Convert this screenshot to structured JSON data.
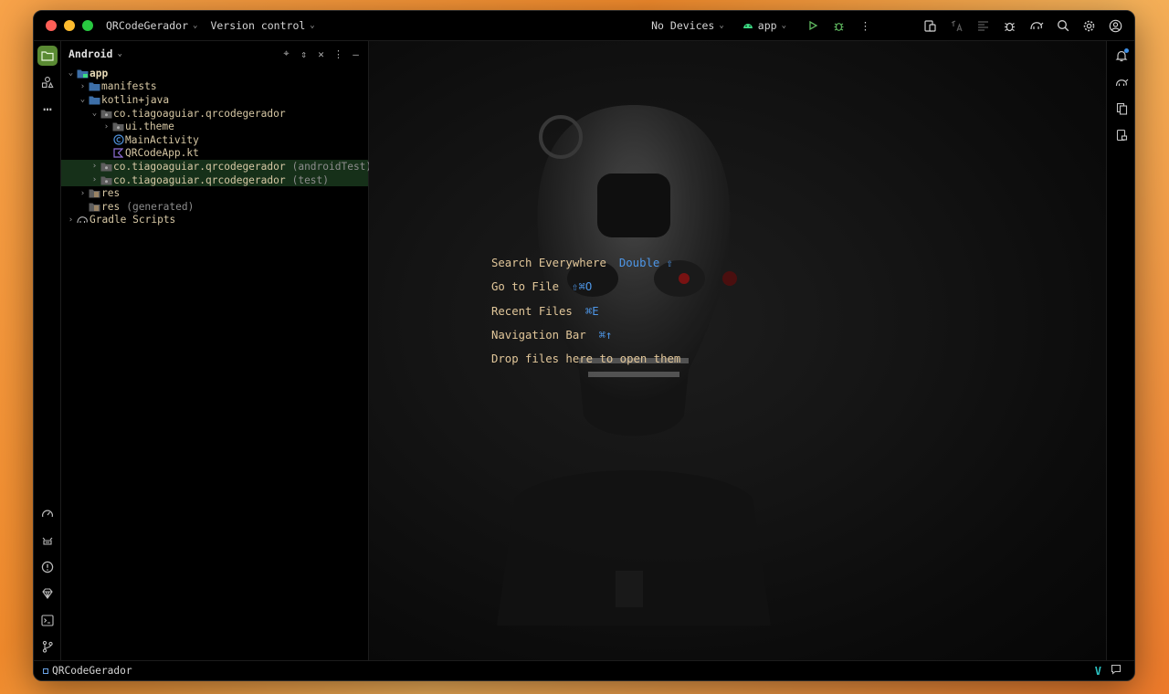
{
  "titlebar": {
    "project_name": "QRCodeGerador",
    "vcs_label": "Version control",
    "device_label": "No Devices",
    "run_config": "app"
  },
  "project_panel": {
    "view_name": "Android",
    "tree": {
      "app": "app",
      "manifests": "manifests",
      "kotlin_java": "kotlin+java",
      "pkg_main": "co.tiagoaguiar.qrcodegerador",
      "ui_theme": "ui.theme",
      "main_activity": "MainActivity",
      "qrcode_app": "QRCodeApp.kt",
      "pkg_android_test": "co.tiagoaguiar.qrcodegerador",
      "pkg_android_test_suffix": "(androidTest)",
      "pkg_test": "co.tiagoaguiar.qrcodegerador",
      "pkg_test_suffix": "(test)",
      "res": "res",
      "res_generated": "res",
      "res_generated_suffix": "(generated)",
      "gradle_scripts": "Gradle Scripts"
    }
  },
  "editor_hints": {
    "search_everywhere": "Search Everywhere",
    "search_everywhere_key": "Double ⇧",
    "go_to_file": "Go to File",
    "go_to_file_key": "⇧⌘O",
    "recent_files": "Recent Files",
    "recent_files_key": "⌘E",
    "navigation_bar": "Navigation Bar",
    "navigation_bar_key": "⌘↑",
    "drop_files": "Drop files here to open them"
  },
  "statusbar": {
    "project_name": "QRCodeGerador"
  },
  "colors": {
    "accent_green": "#5a8a33",
    "selection_bg": "#163019",
    "hint_text": "#e2c79a",
    "shortcut_key": "#4e97e8"
  }
}
